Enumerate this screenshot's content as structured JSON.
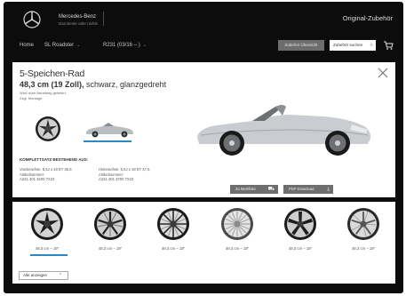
{
  "header": {
    "brand_name": "Mercedes-Benz",
    "brand_tagline": "Das Beste oder nichts",
    "site_title": "Original-Zubehör"
  },
  "nav": {
    "items": [
      {
        "label": "Home"
      },
      {
        "label": "SL Roadster",
        "dropdown": true
      },
      {
        "label": "R231 (03/16 – )",
        "dropdown": true
      }
    ],
    "compare_label": "Zubehör Übersicht",
    "search_placeholder": "Zubehör suchen",
    "icons": {
      "search": "search-icon",
      "cart": "cart-icon"
    }
  },
  "product": {
    "title": "5-Speichen-Rad",
    "size_bold": "48,3 cm (19 Zoll),",
    "size_rest": " schwarz, glanzgedreht",
    "note1": "Wird ohne Bereifung geliefert.",
    "note2": "Zzgl. Montage.",
    "set_title": "KOMPLETTSATZ BESTEHEND AUS:",
    "front": {
      "line1": "Vorderachse: 8,5J x 19 ET 35,5",
      "line2": "Artikelnummer:",
      "line3": "A231 401 3400 7X23"
    },
    "rear": {
      "line1": "Hinterachse: 9,5J x 19 ET 47,5",
      "line2": "Artikelnummer:",
      "line3": "A231 401 3700 7X23"
    },
    "buttons": {
      "cart_label": "Zu Merkliste",
      "pdf_label": "PDF-Download"
    }
  },
  "wheels": [
    {
      "label": "48,3 cm – 19\"",
      "selected": true
    },
    {
      "label": "48,3 cm – 19\""
    },
    {
      "label": "48,3 cm – 19\""
    },
    {
      "label": "48,3 cm – 19\""
    },
    {
      "label": "48,3 cm – 19\""
    },
    {
      "label": "48,3 cm – 19\""
    }
  ],
  "show_all": {
    "label": "Alle anzeigen"
  },
  "colors": {
    "accent": "#2c86c7",
    "header_bg": "#0c0c0c",
    "button_bg": "#6e6e6e"
  }
}
